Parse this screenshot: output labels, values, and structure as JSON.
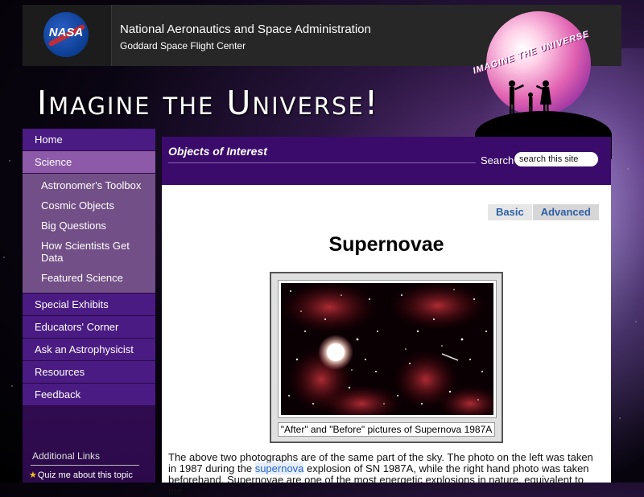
{
  "header": {
    "agency": "National Aeronautics and Space Administration",
    "center": "Goddard Space Flight Center",
    "nasa_logo_text": "NASA"
  },
  "logo": {
    "text": "IMAGINE THE UNIVERSE"
  },
  "banner": {
    "title": "Imagine the Universe!"
  },
  "sidebar": {
    "items": [
      {
        "label": "Home"
      },
      {
        "label": "Science"
      },
      {
        "label": "Special Exhibits"
      },
      {
        "label": "Educators' Corner"
      },
      {
        "label": "Ask an Astrophysicist"
      },
      {
        "label": "Resources"
      },
      {
        "label": "Feedback"
      }
    ],
    "science_sub": [
      {
        "label": "Astronomer's Toolbox"
      },
      {
        "label": "Cosmic Objects"
      },
      {
        "label": "Big Questions"
      },
      {
        "label": "How Scientists Get Data"
      },
      {
        "label": "Featured Science"
      }
    ],
    "additional_links_title": "Additional Links",
    "quiz_label": "Quiz me about this topic"
  },
  "main": {
    "section_title": "Objects of Interest",
    "search_label": "Search",
    "search_placeholder": "search this site",
    "tabs": {
      "basic": "Basic",
      "advanced": "Advanced"
    },
    "page_title": "Supernovae",
    "figure_caption": "\"After\" and \"Before\" pictures of Supernova 1987A",
    "body": {
      "part1": "The above two photographs are of the same part of the sky. The photo on the left was taken in 1987 during the ",
      "link": "supernova",
      "part2": " explosion of SN 1987A, while the right hand photo was taken beforehand. Supernovae are one of the most energetic explosions in nature, equivalent to the"
    }
  },
  "colors": {
    "nav_bg": "#4a1b82",
    "nav_active": "#8c5aa8",
    "section_header": "#3a0b6a",
    "tab_text": "#2d5fa6",
    "link": "#2a66c4"
  }
}
